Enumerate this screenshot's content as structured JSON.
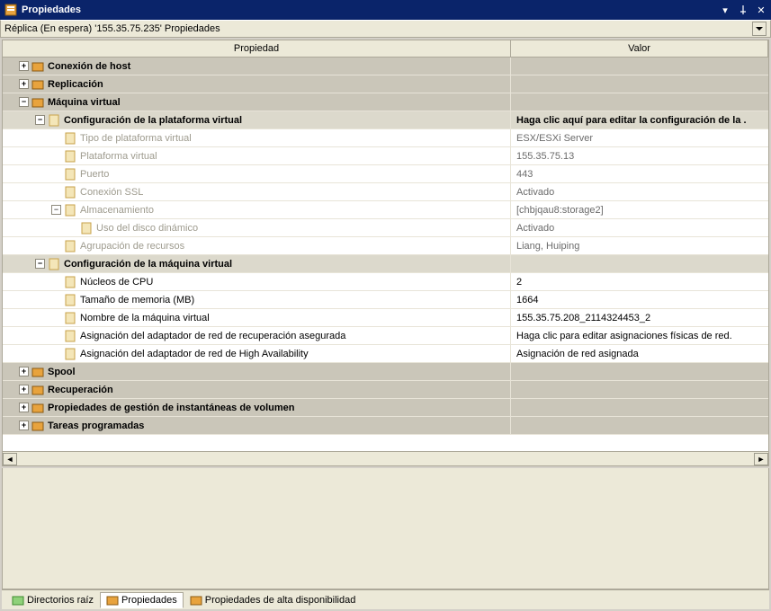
{
  "titlebar": {
    "title": "Propiedades"
  },
  "subbar": {
    "title": "Réplica (En espera)  '155.35.75.235' Propiedades"
  },
  "columns": {
    "property": "Propiedad",
    "value": "Valor"
  },
  "tree": {
    "hostconn": {
      "label": "Conexión de host"
    },
    "replication": {
      "label": "Replicación"
    },
    "vm": {
      "label": "Máquina virtual"
    },
    "vp": {
      "label": "Configuración de la plataforma virtual",
      "value": "Haga clic aquí para editar la configuración de la .",
      "children": {
        "type": {
          "label": "Tipo de plataforma virtual",
          "value": "ESX/ESXi Server"
        },
        "platform": {
          "label": "Plataforma virtual",
          "value": "155.35.75.13"
        },
        "port": {
          "label": "Puerto",
          "value": "443"
        },
        "ssl": {
          "label": "Conexión SSL",
          "value": "Activado"
        },
        "storage": {
          "label": "Almacenamiento",
          "value": "[chbjqau8:storage2]",
          "children": {
            "dyn": {
              "label": "Uso del disco dinámico",
              "value": "Activado"
            }
          }
        },
        "resgroup": {
          "label": "Agrupación de recursos",
          "value": "Liang, Huiping"
        }
      }
    },
    "vmcfg": {
      "label": "Configuración de la máquina virtual",
      "children": {
        "cpu": {
          "label": "Núcleos de CPU",
          "value": "2"
        },
        "mem": {
          "label": "Tamaño de memoria (MB)",
          "value": "1664"
        },
        "name": {
          "label": "Nombre de la máquina virtual",
          "value": "155.35.75.208_2114324453_2"
        },
        "ar": {
          "label": "Asignación del adaptador de red de recuperación asegurada",
          "value": "Haga clic para editar asignaciones físicas de red."
        },
        "ha": {
          "label": "Asignación del adaptador de red de High Availability",
          "value": "Asignación de red asignada"
        }
      }
    },
    "spool": {
      "label": "Spool"
    },
    "recovery": {
      "label": "Recuperación"
    },
    "vsm": {
      "label": "Propiedades de gestión de instantáneas de volumen"
    },
    "sched": {
      "label": "Tareas programadas"
    }
  },
  "tabs": {
    "root": "Directorios raíz",
    "props": "Propiedades",
    "ha": "Propiedades de alta disponibilidad"
  }
}
